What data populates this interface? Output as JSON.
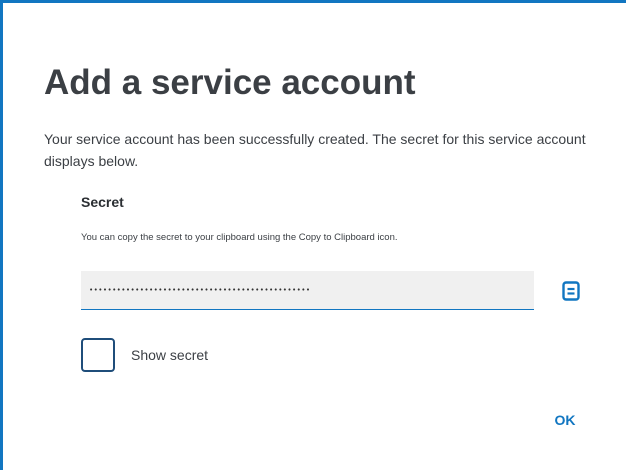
{
  "dialog": {
    "title": "Add a service account",
    "description": "Your service account has been successfully created. The secret for this service account displays below."
  },
  "secret": {
    "label": "Secret",
    "help_text": "You can copy the secret to your clipboard using the Copy to Clipboard icon.",
    "masked_value": "••••••••••••••••••••••••••••••••••••••••••••••••",
    "copy_icon": "clipboard-icon"
  },
  "show_secret": {
    "label": "Show secret",
    "checked": false
  },
  "actions": {
    "ok_label": "OK"
  },
  "colors": {
    "accent": "#1176c1",
    "text": "#3b3f44",
    "field_background": "#f0f0f0",
    "checkbox_border": "#1f4d7a"
  }
}
